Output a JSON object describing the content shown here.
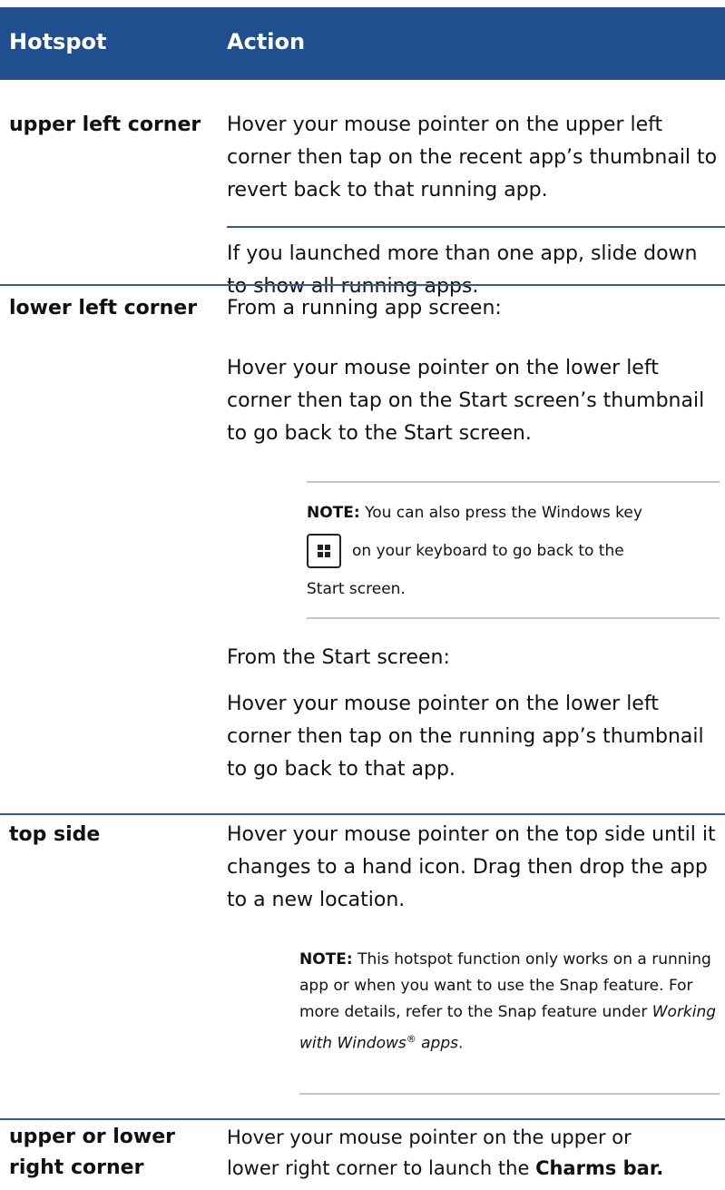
{
  "table": {
    "header": {
      "hotspot": "Hotspot",
      "action": "Action"
    },
    "rows": [
      {
        "hotspot": "upper left corner",
        "paras": [
          "Hover your mouse pointer on the upper left corner then tap on the recent app’s thumbnail to revert back to that running app.",
          "If you launched more than one app, slide down to show all running apps."
        ]
      },
      {
        "hotspot": "lower left corner",
        "paras": [
          "From a running app screen:",
          "Hover your mouse pointer on the lower left corner then tap on the Start screen’s thumbnail to go back to the Start screen.",
          "From the Start screen:",
          "Hover your mouse pointer on the lower left corner then tap on the running app’s thumbnail to go back to that app."
        ],
        "note": {
          "label": "NOTE:",
          "line1": "You can also press the Windows key",
          "line2": "on your keyboard to go back to the",
          "line3": "Start screen."
        }
      },
      {
        "hotspot": "top side",
        "paras": [
          "Hover your mouse pointer on the top side until it changes to a hand icon. Drag then drop the app to a new location."
        ],
        "note": {
          "label": "NOTE:",
          "text": "This hotspot function only works on a running app or when you want to use the Snap feature. For more details, refer to the Snap feature under",
          "italic": "Working with Windows",
          "sup": "®",
          "italic2": "apps",
          "end": "."
        }
      },
      {
        "hotspot_line1": "upper or lower",
        "hotspot_line2": "right corner",
        "action_line1": "Hover your mouse pointer on the upper or",
        "action_line2_pre": "lower right corner to launch the",
        "action_bold": "Charms bar."
      }
    ]
  },
  "colors": {
    "header_bg": "#1f4f8e",
    "rule": "#2b5c9e",
    "note_rule": "#c6c6c6"
  },
  "icons": {
    "windows_key": "windows-logo-icon"
  }
}
